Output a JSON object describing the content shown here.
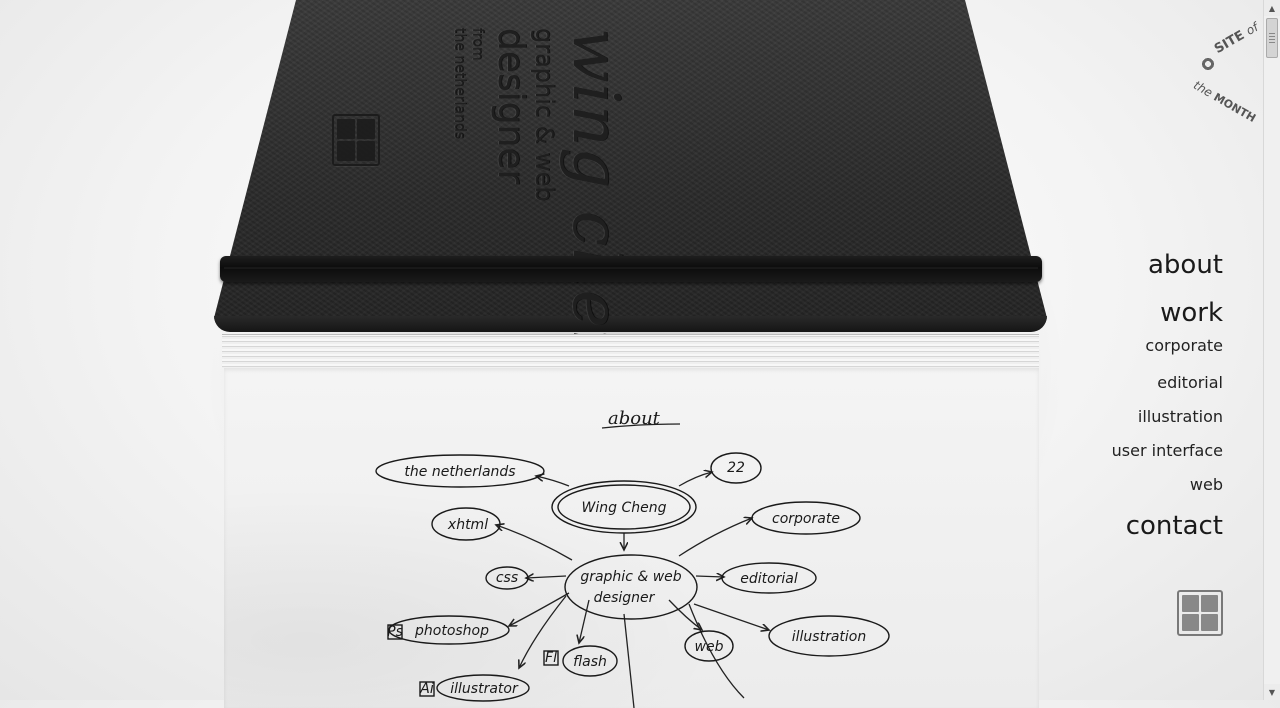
{
  "cover": {
    "name": "wing cheng",
    "role_line1": "graphic & web",
    "role_line2": "designer",
    "from": "from",
    "country": "the netherlands"
  },
  "mindmap": {
    "title": "about",
    "center": "Wing Cheng",
    "role": [
      "graphic & web",
      "designer"
    ],
    "nodes": {
      "country": "the netherlands",
      "age": "22",
      "xhtml": "xhtml",
      "css": "css",
      "photoshop": "photoshop",
      "flash": "flash",
      "illustrator": "illustrator",
      "corporate": "corporate",
      "editorial": "editorial",
      "web": "web",
      "illustration": "illustration",
      "ps_tag": "Ps",
      "fl_tag": "Fl",
      "ai_tag": "Ai"
    }
  },
  "nav": {
    "about": "about",
    "work": "work",
    "corporate": "corporate",
    "editorial": "editorial",
    "illustration": "illustration",
    "user_interface": "user interface",
    "web": "web",
    "contact": "contact"
  },
  "badge": {
    "site": "SITE",
    "of": "of",
    "the": "the",
    "month": "MONTH"
  },
  "scrollbar": {
    "up": "▲",
    "down": "▼"
  }
}
